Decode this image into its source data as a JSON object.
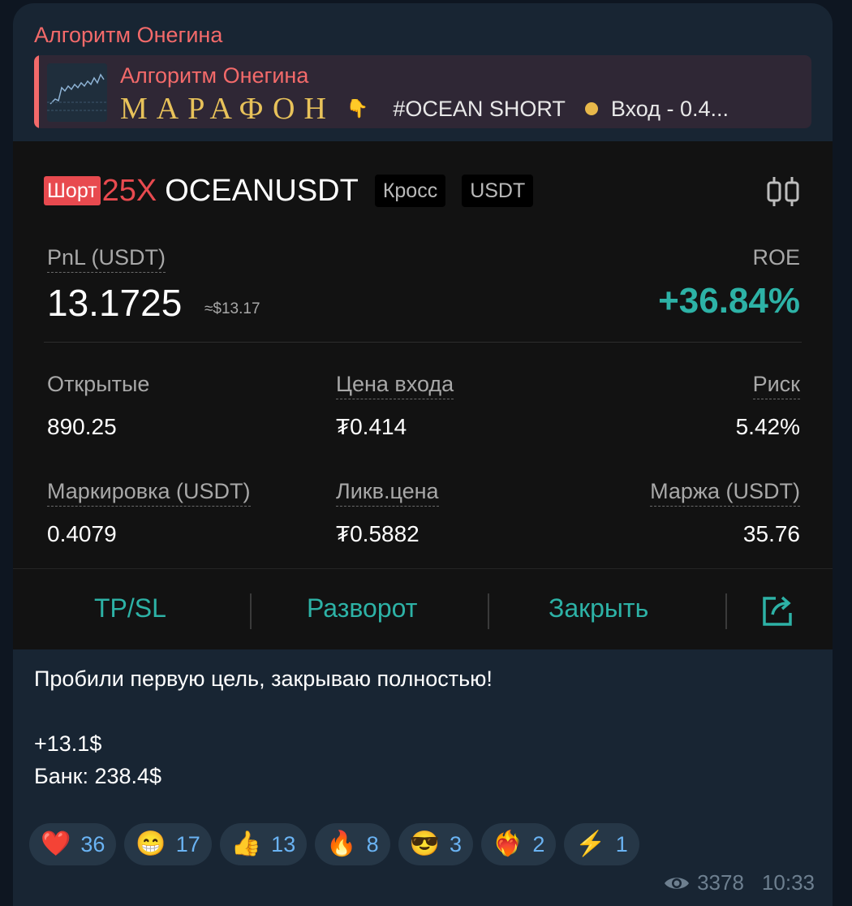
{
  "channel": {
    "name": "Алгоритм Онегина"
  },
  "reply": {
    "title": "Алгоритм Онегина",
    "marathon": "МАРАФОН",
    "pointer_emoji": "👇",
    "text": "#OCEAN SHORT",
    "entry": "Вход - 0.4..."
  },
  "card": {
    "side_badge": "Шорт",
    "leverage": "25X",
    "symbol": "OCEANUSDT",
    "margin_mode": "Кросс",
    "settle": "USDT",
    "pnl_label": "PnL (USDT)",
    "pnl_value": "13.1725",
    "pnl_usd": "≈$13.17",
    "roe_label": "ROE",
    "roe_value": "+36.84%",
    "stats": {
      "open_label": "Открытые",
      "open_value": "890.25",
      "entry_label": "Цена входа",
      "entry_value": "₮0.414",
      "risk_label": "Риск",
      "risk_value": "5.42%",
      "mark_label": "Маркировка (USDT)",
      "mark_value": "0.4079",
      "liq_label": "Ликв.цена",
      "liq_value": "₮0.5882",
      "margin_label": "Маржа (USDT)",
      "margin_value": "35.76"
    },
    "actions": {
      "tpsl": "TP/SL",
      "reverse": "Разворот",
      "close": "Закрыть"
    }
  },
  "message": {
    "line1": "Пробили первую цель, закрываю полностью!",
    "line2": "+13.1$",
    "line3": "Банк: 238.4$"
  },
  "reactions": [
    {
      "emoji": "❤️",
      "count": "36"
    },
    {
      "emoji": "😁",
      "count": "17"
    },
    {
      "emoji": "👍",
      "count": "13"
    },
    {
      "emoji": "🔥",
      "count": "8"
    },
    {
      "emoji": "😎",
      "count": "3"
    },
    {
      "emoji": "❤️‍🔥",
      "count": "2"
    },
    {
      "emoji": "⚡",
      "count": "1"
    }
  ],
  "meta": {
    "views": "3378",
    "time": "10:33"
  },
  "colors": {
    "accent_red": "#f36a6a",
    "teal": "#2db2a6",
    "short_red": "#e84a4f",
    "link_blue": "#6ab3f3"
  }
}
